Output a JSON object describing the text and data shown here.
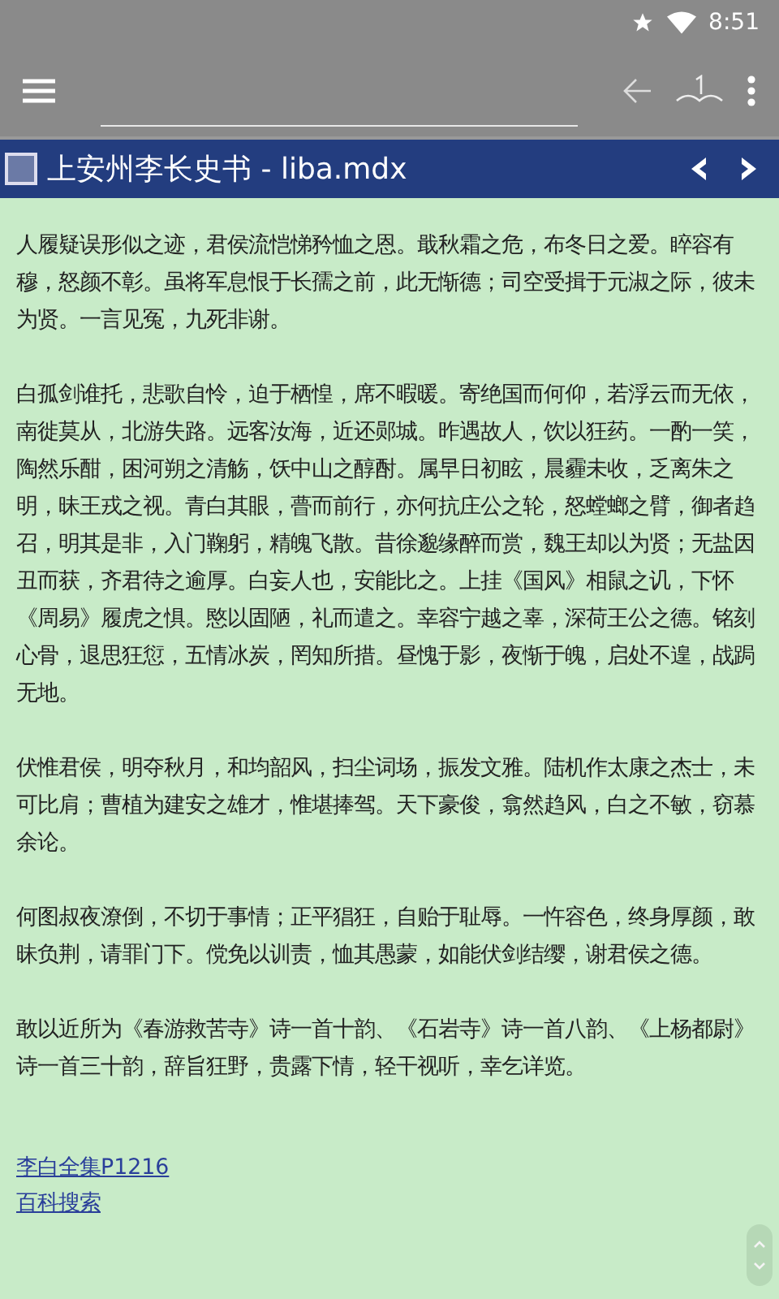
{
  "status_bar": {
    "time": "8:51"
  },
  "title_bar": {
    "title": "上安州李长史书 - liba.mdx",
    "checkbox": {
      "checked": false
    }
  },
  "paragraphs": [
    "人履疑误形似之迹，君侯流恺悌矜恤之恩。戢秋霜之危，布冬日之爱。睟容有穆，怒颜不彰。虽将军息恨于长孺之前，此无惭德；司空受揖于元淑之际，彼未为贤。一言见冤，九死非谢。",
    "白孤剑谁托，悲歌自怜，迫于栖惶，席不暇暖。寄绝国而何仰，若浮云而无依，南徙莫从，北游失路。远客汝海，近还郧城。昨遇故人，饮以狂药。一酌一笑，陶然乐酣，困河朔之清觞，饫中山之醇酎。属早日初眩，晨霾未收，乏离朱之明，昧王戎之视。青白其眼，瞢而前行，亦何抗庄公之轮，怒螳螂之臂，御者趋召，明其是非，入门鞠躬，精魄飞散。昔徐邈缘醉而赏，魏王却以为贤；无盐因丑而获，齐君待之逾厚。白妄人也，安能比之。上挂《国风》相鼠之讥，下怀《周易》履虎之惧。愍以固陋，礼而遣之。幸容宁越之辜，深荷王公之德。铭刻心骨，退思狂愆，五情冰炭，罔知所措。昼愧于影，夜惭于魄，启处不遑，战跼无地。",
    "伏惟君侯，明夺秋月，和均韶风，扫尘词场，振发文雅。陆机作太康之杰士，未可比肩；曹植为建安之雄才，惟堪捧驾。天下豪俊，翕然趋风，白之不敏，窃慕余论。",
    "何图叔夜潦倒，不切于事情；正平猖狂，自贻于耻辱。一忤容色，终身厚颜，敢昧负荆，请罪门下。傥免以训责，恤其愚蒙，如能伏剑结缨，谢君侯之德。",
    "敢以近所为《春游救苦寺》诗一首十韵、《石岩寺》诗一首八韵、《上杨都尉》诗一首三十韵，辞旨狂野，贵露下情，轻干视听，幸乞详览。"
  ],
  "links": [
    "李白全集P1216",
    "百科搜索"
  ]
}
